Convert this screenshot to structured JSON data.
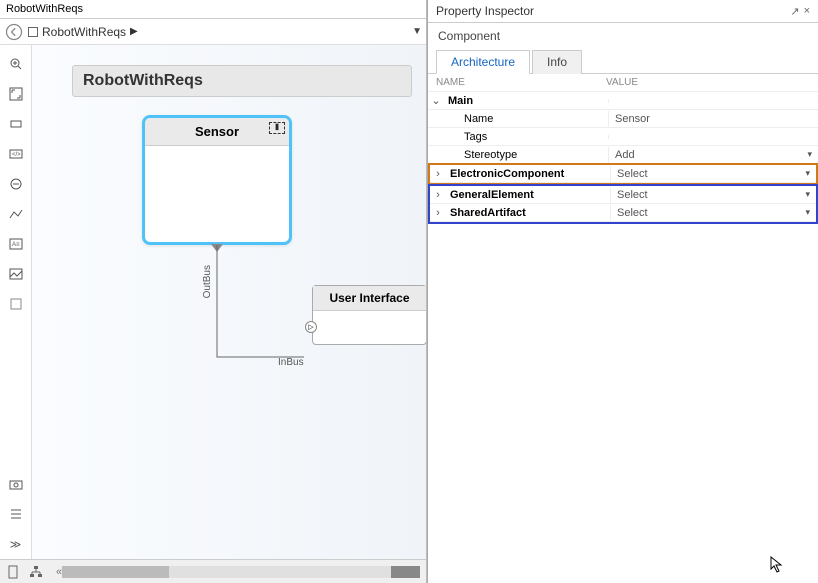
{
  "tab": {
    "title": "RobotWithReqs"
  },
  "breadcrumb": {
    "item": "RobotWithReqs"
  },
  "model": {
    "title": "RobotWithReqs"
  },
  "sensor": {
    "label": "Sensor"
  },
  "ports": {
    "outbus": "OutBus",
    "inbus": "InBus"
  },
  "userif": {
    "label": "User Interface"
  },
  "inspector": {
    "title": "Property Inspector",
    "component_label": "Component",
    "tabs": {
      "architecture": "Architecture",
      "info": "Info"
    },
    "cols": {
      "name": "NAME",
      "value": "VALUE"
    },
    "main": {
      "label": "Main",
      "rows": {
        "name": {
          "label": "Name",
          "value": "Sensor"
        },
        "tags": {
          "label": "Tags",
          "value": ""
        },
        "stereotype": {
          "label": "Stereotype",
          "value": "Add"
        }
      }
    },
    "stereotypes": {
      "electronic": {
        "label": "ElectronicComponent",
        "value": "Select"
      },
      "general": {
        "label": "GeneralElement",
        "value": "Select"
      },
      "shared": {
        "label": "SharedArtifact",
        "value": "Select"
      }
    }
  }
}
